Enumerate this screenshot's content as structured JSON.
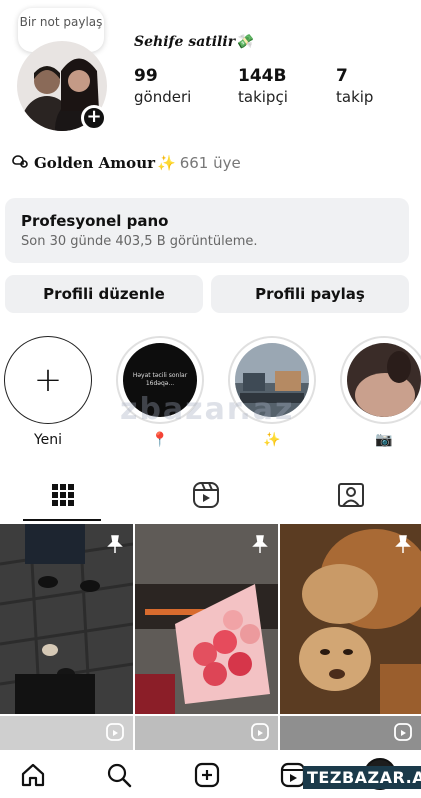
{
  "note": {
    "text": "Bir not paylaş"
  },
  "profile": {
    "page_name": "Sehife satilir💸"
  },
  "stats": [
    {
      "value": "99",
      "label": "gönderi"
    },
    {
      "value": "144B",
      "label": "takipçi"
    },
    {
      "value": "7",
      "label": "takip"
    }
  ],
  "channel": {
    "name": "Golden Amour",
    "emoji": "✨",
    "members": "661 üye"
  },
  "pro_panel": {
    "title": "Profesyonel pano",
    "subtitle": "Son 30 günde 403,5 B görüntüleme."
  },
  "buttons": {
    "edit": "Profili düzenle",
    "share": "Profili paylaş"
  },
  "highlights": [
    {
      "label": "Yeni",
      "icon": "plus-icon"
    },
    {
      "label": "📍",
      "caption": "Həyat təcili sonlar 16dəqə..."
    },
    {
      "label": "✨"
    },
    {
      "label": "📷"
    }
  ],
  "tabs": [
    {
      "icon": "grid-icon",
      "active": true
    },
    {
      "icon": "reels-icon",
      "active": false
    },
    {
      "icon": "tagged-icon",
      "active": false
    }
  ],
  "nav": [
    {
      "icon": "home-icon"
    },
    {
      "icon": "search-icon"
    },
    {
      "icon": "create-icon"
    },
    {
      "icon": "reels-icon"
    },
    {
      "icon": "profile-avatar"
    }
  ],
  "watermark": {
    "text": "TEZBAZAR.AZ",
    "center": "zbazar.az"
  },
  "colors": {
    "accent": "#111111",
    "panel": "#f0f1f3",
    "sparkle": "#f5b400"
  }
}
